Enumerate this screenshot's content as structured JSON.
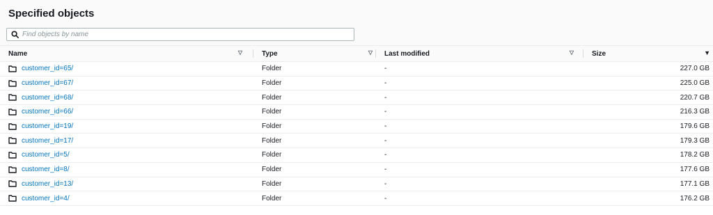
{
  "panel": {
    "title": "Specified objects",
    "search_placeholder": "Find objects by name"
  },
  "table": {
    "columns": {
      "name": "Name",
      "type": "Type",
      "last_modified": "Last modified",
      "size": "Size"
    },
    "rows": [
      {
        "name": "customer_id=65/",
        "type": "Folder",
        "last_modified": "-",
        "size": "227.0 GB"
      },
      {
        "name": "customer_id=67/",
        "type": "Folder",
        "last_modified": "-",
        "size": "225.0 GB"
      },
      {
        "name": "customer_id=68/",
        "type": "Folder",
        "last_modified": "-",
        "size": "220.7 GB"
      },
      {
        "name": "customer_id=66/",
        "type": "Folder",
        "last_modified": "-",
        "size": "216.3 GB"
      },
      {
        "name": "customer_id=19/",
        "type": "Folder",
        "last_modified": "-",
        "size": "179.6 GB"
      },
      {
        "name": "customer_id=17/",
        "type": "Folder",
        "last_modified": "-",
        "size": "179.3 GB"
      },
      {
        "name": "customer_id=5/",
        "type": "Folder",
        "last_modified": "-",
        "size": "178.2 GB"
      },
      {
        "name": "customer_id=8/",
        "type": "Folder",
        "last_modified": "-",
        "size": "177.6 GB"
      },
      {
        "name": "customer_id=13/",
        "type": "Folder",
        "last_modified": "-",
        "size": "177.1 GB"
      },
      {
        "name": "customer_id=4/",
        "type": "Folder",
        "last_modified": "-",
        "size": "176.2 GB"
      }
    ]
  },
  "icons": {
    "search": "search-icon",
    "folder": "folder-icon",
    "sort_inactive": "sort-icon",
    "sort_active": "sort-descending-icon"
  },
  "colors": {
    "link": "#0073bb",
    "header_bg": "#fafafa",
    "border": "#eaeded"
  }
}
